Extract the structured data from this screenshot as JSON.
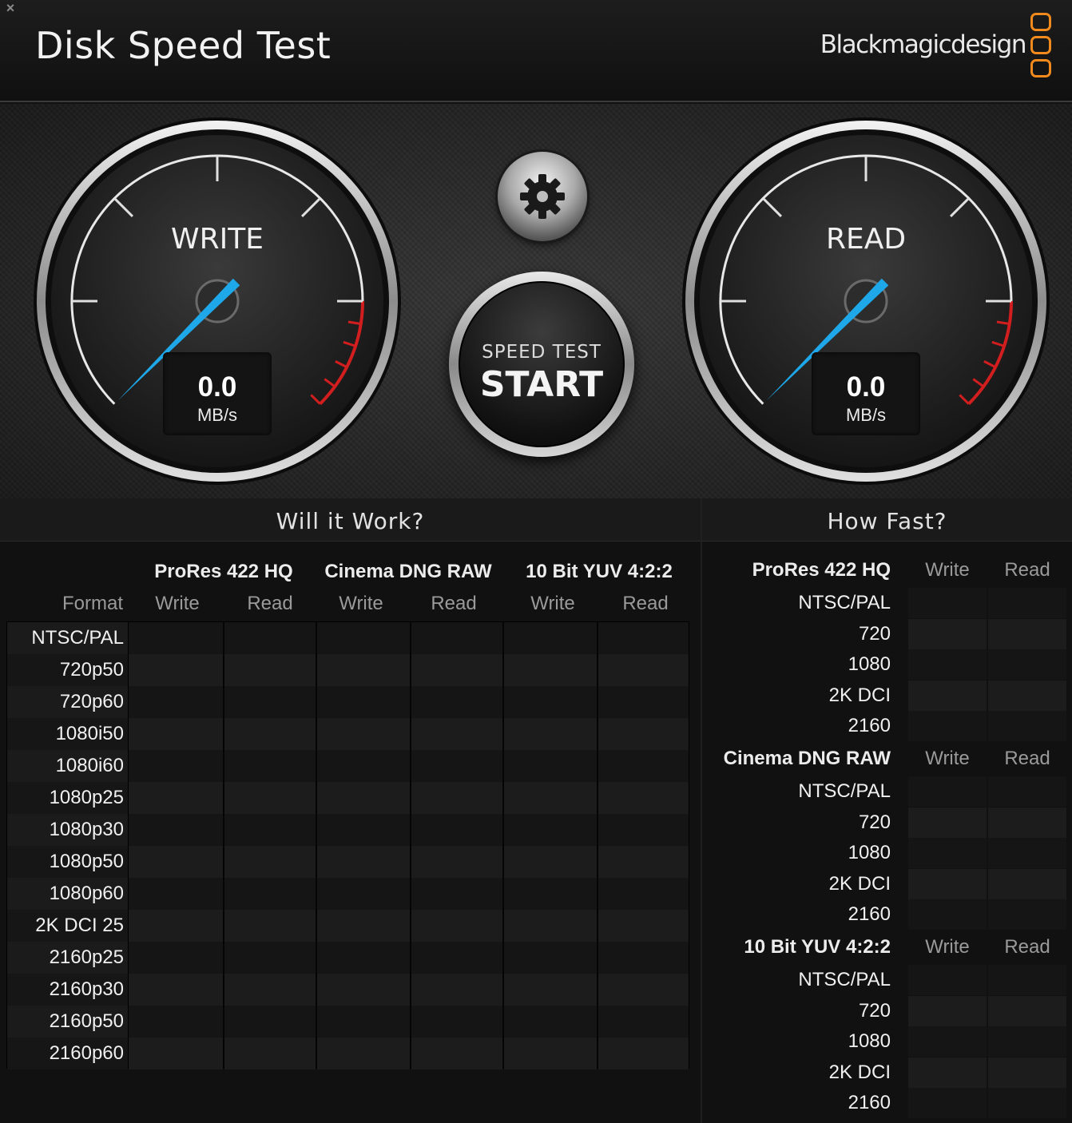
{
  "header": {
    "close": "×",
    "title": "Disk Speed Test",
    "brand": "Blackmagicdesign"
  },
  "colors": {
    "accent": "#f08a1c",
    "needle": "#1ea8ea",
    "redline": "#d21e1e"
  },
  "gauges": {
    "write": {
      "label": "WRITE",
      "value": "0.0",
      "unit": "MB/s"
    },
    "read": {
      "label": "READ",
      "value": "0.0",
      "unit": "MB/s"
    }
  },
  "controls": {
    "settings_icon": "gear-icon",
    "start_top": "SPEED TEST",
    "start_main": "START"
  },
  "will_it_work": {
    "title": "Will it Work?",
    "format_label": "Format",
    "codecs": [
      "ProRes 422 HQ",
      "Cinema DNG RAW",
      "10 Bit YUV 4:2:2"
    ],
    "write_label": "Write",
    "read_label": "Read",
    "formats": [
      "NTSC/PAL",
      "720p50",
      "720p60",
      "1080i50",
      "1080i60",
      "1080p25",
      "1080p30",
      "1080p50",
      "1080p60",
      "2K DCI 25",
      "2160p25",
      "2160p30",
      "2160p50",
      "2160p60"
    ]
  },
  "how_fast": {
    "title": "How Fast?",
    "write_label": "Write",
    "read_label": "Read",
    "groups": [
      {
        "codec": "ProRes 422 HQ",
        "rows": [
          "NTSC/PAL",
          "720",
          "1080",
          "2K DCI",
          "2160"
        ]
      },
      {
        "codec": "Cinema DNG RAW",
        "rows": [
          "NTSC/PAL",
          "720",
          "1080",
          "2K DCI",
          "2160"
        ]
      },
      {
        "codec": "10 Bit YUV 4:2:2",
        "rows": [
          "NTSC/PAL",
          "720",
          "1080",
          "2K DCI",
          "2160"
        ]
      }
    ]
  }
}
